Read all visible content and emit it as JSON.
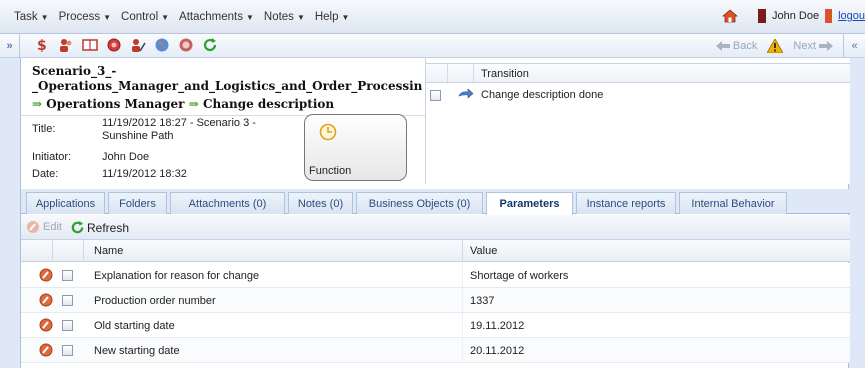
{
  "menu": {
    "items": [
      {
        "label": "Task"
      },
      {
        "label": "Process"
      },
      {
        "label": "Control"
      },
      {
        "label": "Attachments"
      },
      {
        "label": "Notes"
      },
      {
        "label": "Help"
      }
    ],
    "user_name": "John Doe",
    "logout_label": "logou"
  },
  "toolbar": {
    "collapse_left": "»",
    "collapse_right": "«",
    "back_label": "Back",
    "next_label": "Next"
  },
  "info": {
    "scenario_line1": "Scenario_3_-",
    "scenario_line2": "_Operations_Manager_and_Logistics_and_Order_Processing",
    "path_role": "Operations Manager",
    "path_step": "Change description",
    "title_label": "Title:",
    "title_value_line1": "11/19/2012 18:27 - Scenario 3 -",
    "title_value_line2": "Sunshine Path",
    "initiator_label": "Initiator:",
    "initiator_value": "John Doe",
    "date_label": "Date:",
    "date_value": "11/19/2012 18:32",
    "function_label": "Function"
  },
  "transitions": {
    "header": "Transition",
    "rows": [
      {
        "label": "Change description done"
      }
    ]
  },
  "tabs": [
    {
      "label": "Applications"
    },
    {
      "label": "Folders"
    },
    {
      "label": "Attachments (0)"
    },
    {
      "label": "Notes (0)"
    },
    {
      "label": "Business Objects (0)"
    },
    {
      "label": "Parameters",
      "active": true
    },
    {
      "label": "Instance reports"
    },
    {
      "label": "Internal Behavior"
    }
  ],
  "grid_toolbar": {
    "edit_label": "Edit",
    "refresh_label": "Refresh"
  },
  "grid": {
    "columns": [
      "Name",
      "Value"
    ],
    "rows": [
      {
        "name": "Explanation for reason for change",
        "value": "Shortage of workers"
      },
      {
        "name": "Production order number",
        "value": "1337"
      },
      {
        "name": "Old starting date",
        "value": "19.11.2012"
      },
      {
        "name": "New starting date",
        "value": "20.11.2012"
      }
    ]
  },
  "colors": {
    "accent_blue": "#2d4d7f",
    "arrow_green": "#3c9a1e",
    "logout_blue": "#1a47b8"
  }
}
